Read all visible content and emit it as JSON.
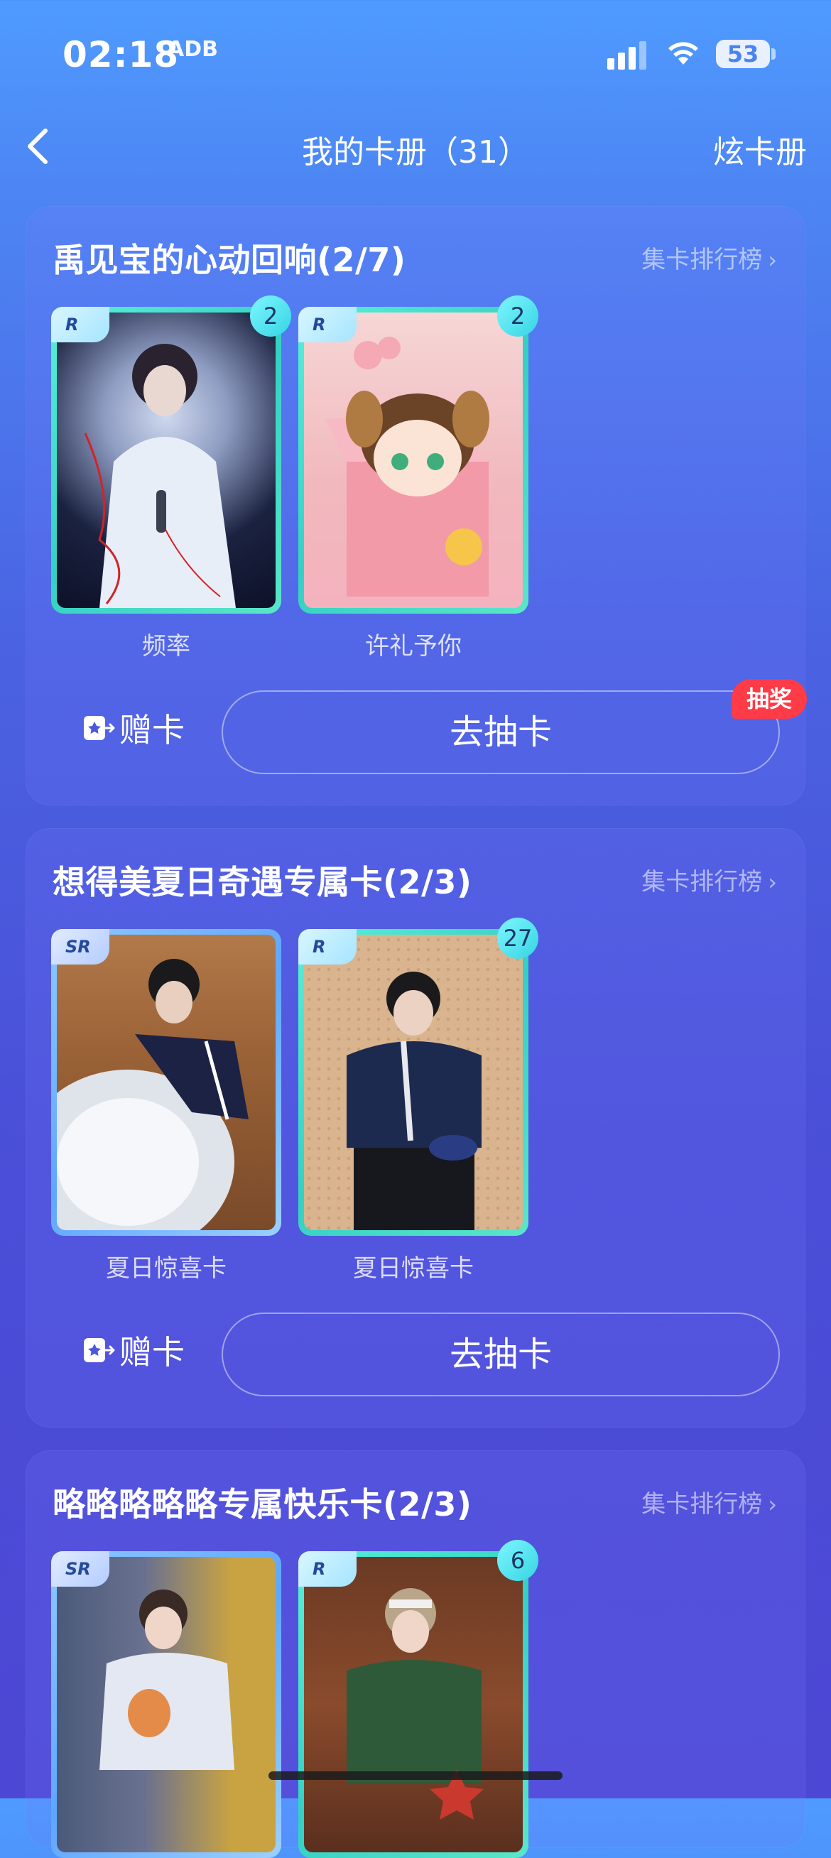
{
  "status": {
    "time": "02:18",
    "time_extra": "ADB",
    "battery": "53"
  },
  "nav": {
    "title": "我的卡册（31）",
    "right": "炫卡册"
  },
  "albums": [
    {
      "title": "禹见宝的心动回响(2/7)",
      "rank": "集卡排行榜",
      "cards": [
        {
          "rarity": "R",
          "count": "2",
          "name": "频率"
        },
        {
          "rarity": "R",
          "count": "2",
          "name": "许礼予你"
        }
      ],
      "gift": "赠卡",
      "draw": "去抽卡",
      "badge": "抽奖"
    },
    {
      "title": "想得美夏日奇遇专属卡(2/3)",
      "rank": "集卡排行榜",
      "cards": [
        {
          "rarity": "SR",
          "count": "",
          "name": "夏日惊喜卡"
        },
        {
          "rarity": "R",
          "count": "27",
          "name": "夏日惊喜卡"
        }
      ],
      "gift": "赠卡",
      "draw": "去抽卡"
    },
    {
      "title": "略略略略略专属快乐卡(2/3)",
      "rank": "集卡排行榜",
      "cards": [
        {
          "rarity": "SR",
          "count": ""
        },
        {
          "rarity": "R",
          "count": "6"
        }
      ]
    }
  ],
  "colors": {
    "accent_badge": "#ff3b47",
    "r_frame": "#34d0c4",
    "sr_frame": "#5fa6ff"
  }
}
